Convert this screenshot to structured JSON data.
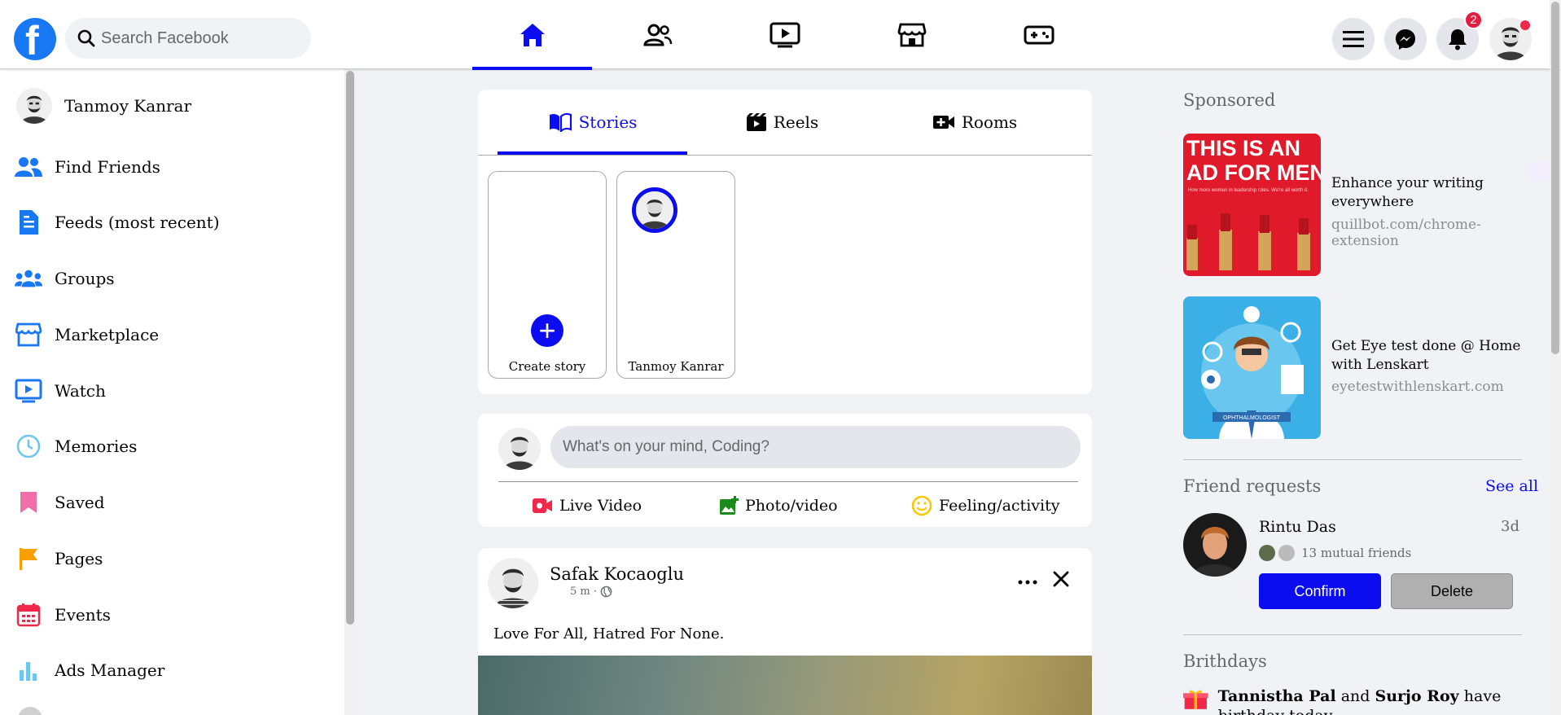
{
  "header": {
    "search_placeholder": "Search Facebook",
    "notifications_count": "2",
    "nav_tabs": [
      "home",
      "friends",
      "watch",
      "marketplace",
      "gaming"
    ],
    "active_tab": "home"
  },
  "sidebar": {
    "profile_name": "Tanmoy Kanrar",
    "items": [
      {
        "label": "Find Friends",
        "icon": "friends-icon",
        "color": "#1877f2"
      },
      {
        "label": "Feeds (most recent)",
        "icon": "feed-icon",
        "color": "#1877f2"
      },
      {
        "label": "Groups",
        "icon": "groups-icon",
        "color": "#1877f2"
      },
      {
        "label": "Marketplace",
        "icon": "marketplace-icon",
        "color": "#1877f2"
      },
      {
        "label": "Watch",
        "icon": "watch-icon",
        "color": "#1877f2"
      },
      {
        "label": "Memories",
        "icon": "clock-icon",
        "color": "#4fc3f7"
      },
      {
        "label": "Saved",
        "icon": "bookmark-icon",
        "color": "#e91e8c"
      },
      {
        "label": "Pages",
        "icon": "flag-icon",
        "color": "#f7b928"
      },
      {
        "label": "Events",
        "icon": "calendar-icon",
        "color": "#f02849"
      },
      {
        "label": "Ads Manager",
        "icon": "chart-icon",
        "color": "#4fc3f7"
      }
    ]
  },
  "stories": {
    "tabs": [
      "Stories",
      "Reels",
      "Rooms"
    ],
    "create_label": "Create story",
    "user_story_label": "Tanmoy Kanrar"
  },
  "composer": {
    "placeholder": "What's on your mind, Coding?",
    "actions": [
      "Live Video",
      "Photo/video",
      "Feeling/activity"
    ]
  },
  "post": {
    "author": "Safak Kocaoglu",
    "time": "5 m",
    "text": "Love For All, Hatred For None."
  },
  "right": {
    "sponsored_title": "Sponsored",
    "ads": [
      {
        "image_text_1": "THIS IS AN",
        "image_text_2": "AD FOR MEN",
        "image_small": "How more women in leadership roles. We're all worth it.",
        "text": "Enhance your writing everywhere",
        "url": "quillbot.com/chrome-extension"
      },
      {
        "image_caption": "OPHTHALMOLOGIST",
        "text": "Get Eye test done @ Home with Lenskart",
        "url": "eyetestwithlenskart.com"
      }
    ],
    "friend_requests_title": "Friend requests",
    "see_all": "See all",
    "request": {
      "name": "Rintu Das",
      "time": "3d",
      "mutual": "13 mutual friends"
    },
    "confirm_label": "Confirm",
    "delete_label": "Delete",
    "birthdays_title": "Brithdays",
    "birthday": {
      "name1": "Tannistha Pal",
      "and": "and",
      "name2": "Surjo Roy",
      "rest": "have birthday today"
    }
  },
  "colors": {
    "accent": "#0c0cf0",
    "facebook_blue": "#1877f2"
  }
}
